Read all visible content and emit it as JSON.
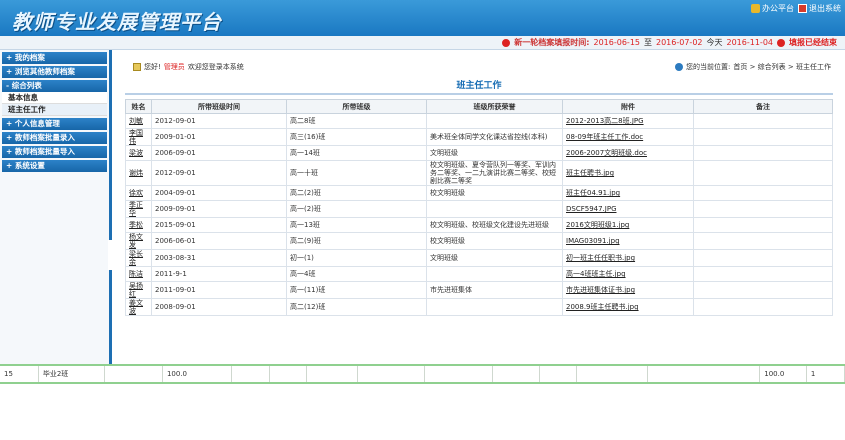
{
  "header": {
    "logo": "教师专业发展管理平台",
    "office_label": "办公平台",
    "exit_label": "退出系统"
  },
  "notice": {
    "prefix": "新一轮档案填报时间:",
    "start": "2016-06-15",
    "to": "至",
    "end": "2016-07-02",
    "today_label": "今天",
    "today": "2016-11-04",
    "closed": "填报已经结束"
  },
  "sidebar": {
    "items": [
      {
        "label": "+ 我的档案"
      },
      {
        "label": "+ 浏览其他教师档案"
      },
      {
        "label": "- 综合列表"
      },
      {
        "label": "基本信息"
      },
      {
        "label": "班主任工作"
      },
      {
        "label": "+ 个人信息管理"
      },
      {
        "label": "+ 教师档案批量录入"
      },
      {
        "label": "+ 教师档案批量导入"
      },
      {
        "label": "+ 系统设置"
      }
    ]
  },
  "crumbs": {
    "hello": "您好!",
    "user": "管理员",
    "welcome": "欢迎您登录本系统",
    "location": "您的当前位置:",
    "path": "首页 > 综合列表 > 班主任工作"
  },
  "panel_title": "班主任工作",
  "table": {
    "headers": [
      "姓名",
      "所带班级时间",
      "所带班级",
      "班级所获荣誉",
      "附件",
      "备注"
    ],
    "rows": [
      {
        "name": "刘敏",
        "time": "2012-09-01",
        "class": "高二8班",
        "honor": "",
        "file": "2012-2013高二8班.JPG",
        "note": ""
      },
      {
        "name": "李国伟",
        "time": "2009-01-01",
        "class": "高三(16)班",
        "honor": "美术班全体同学文化课达省控线(本科)",
        "file": "08-09年班主任工作.doc",
        "note": ""
      },
      {
        "name": "梁波",
        "time": "2006-09-01",
        "class": "高一14班",
        "honor": "文明班级",
        "file": "2006-2007文明班级.doc",
        "note": ""
      },
      {
        "name": "谢炜",
        "time": "2012-09-01",
        "class": "高一十班",
        "honor": "校文明班级、夏令营队列一等奖、军训内务二等奖、一二九演讲比赛二等奖、校短剧比赛二等奖",
        "file": "班主任聘书.jpg",
        "note": ""
      },
      {
        "name": "徐欢",
        "time": "2004-09-01",
        "class": "高二(2)班",
        "honor": "校文明班级",
        "file": "班主任04.91.jpg",
        "note": ""
      },
      {
        "name": "季正华",
        "time": "2009-09-01",
        "class": "高一(2)班",
        "honor": "",
        "file": "DSCF5947.JPG",
        "note": ""
      },
      {
        "name": "季松",
        "time": "2015-09-01",
        "class": "高一13班",
        "honor": "校文明班级、校班级文化建设先进班级",
        "file": "2016文明班级1.jpg",
        "note": ""
      },
      {
        "name": "杨文发",
        "time": "2006-06-01",
        "class": "高二(9)班",
        "honor": "校文明班级",
        "file": "IMAG03091.jpg",
        "note": ""
      },
      {
        "name": "梁长余",
        "time": "2003-08-31",
        "class": "初一(1)",
        "honor": "文明班级",
        "file": "初一班主任任职书.jpg",
        "note": ""
      },
      {
        "name": "陈洁",
        "time": "2011-9-1",
        "class": "高一4班",
        "honor": "",
        "file": "高一4班班主任.jpg",
        "note": ""
      },
      {
        "name": "吴扬红",
        "time": "2011-09-01",
        "class": "高一(11)班",
        "honor": "市先进班集体",
        "file": "市先进班集体证书.jpg",
        "note": ""
      },
      {
        "name": "姜文波",
        "time": "2008-09-01",
        "class": "高二(12)班",
        "honor": "",
        "file": "2008.9班主任聘书.jpg",
        "note": ""
      }
    ]
  },
  "strip": {
    "cells": [
      "15",
      "毕业2班",
      "",
      "100.0",
      "",
      "",
      "",
      "",
      "",
      "",
      "",
      "",
      "",
      "100.0",
      "1"
    ]
  }
}
